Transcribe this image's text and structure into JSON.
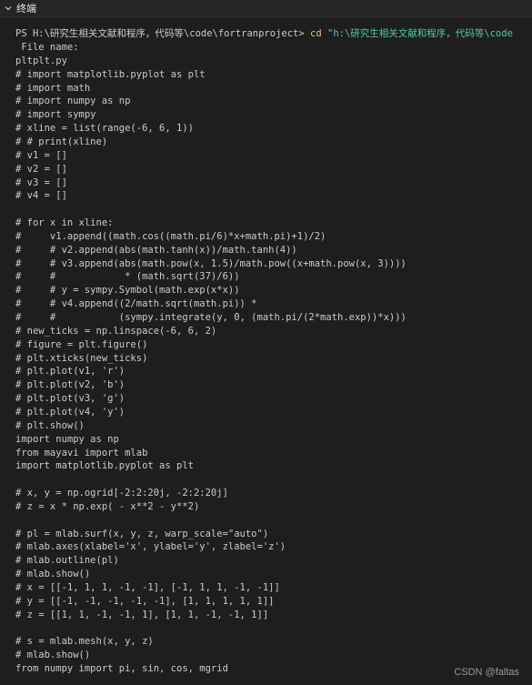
{
  "panel": {
    "title": "终端"
  },
  "terminal": {
    "prompt": {
      "prefix": "PS H:\\研究生相关文献和程序，代码等\\code\\fortranproject> ",
      "command": "cd",
      "argument": " \"h:\\研究生相关文献和程序，代码等\\code"
    },
    "lines": [
      " File name:",
      "pltplt.py",
      "# import matplotlib.pyplot as plt",
      "# import math",
      "# import numpy as np",
      "# import sympy",
      "# xline = list(range(-6, 6, 1))",
      "# # print(xline)",
      "# v1 = []",
      "# v2 = []",
      "# v3 = []",
      "# v4 = []",
      "",
      "# for x in xline:",
      "#     v1.append((math.cos((math.pi/6)*x+math.pi)+1)/2)",
      "#     # v2.append(abs(math.tanh(x))/math.tanh(4))",
      "#     # v3.append(abs(math.pow(x, 1.5)/math.pow((x+math.pow(x, 3))))",
      "#     #            * (math.sqrt(37)/6))",
      "#     # y = sympy.Symbol(math.exp(x*x))",
      "#     # v4.append((2/math.sqrt(math.pi)) *",
      "#     #           (sympy.integrate(y, 0, (math.pi/(2*math.exp))*x)))",
      "# new_ticks = np.linspace(-6, 6, 2)",
      "# figure = plt.figure()",
      "# plt.xticks(new_ticks)",
      "# plt.plot(v1, 'r')",
      "# plt.plot(v2, 'b')",
      "# plt.plot(v3, 'g')",
      "# plt.plot(v4, 'y')",
      "# plt.show()",
      "import numpy as np",
      "from mayavi import mlab",
      "import matplotlib.pyplot as plt",
      "",
      "# x, y = np.ogrid[-2:2:20j, -2:2:20j]",
      "# z = x * np.exp( - x**2 - y**2)",
      "",
      "# pl = mlab.surf(x, y, z, warp_scale=\"auto\")",
      "# mlab.axes(xlabel='x', ylabel='y', zlabel='z')",
      "# mlab.outline(pl)",
      "# mlab.show()",
      "# x = [[-1, 1, 1, -1, -1], [-1, 1, 1, -1, -1]]",
      "# y = [[-1, -1, -1, -1, -1], [1, 1, 1, 1, 1]]",
      "# z = [[1, 1, -1, -1, 1], [1, 1, -1, -1, 1]]",
      "",
      "# s = mlab.mesh(x, y, z)",
      "# mlab.show()",
      "from numpy import pi, sin, cos, mgrid"
    ]
  },
  "watermark": "CSDN @faltas"
}
